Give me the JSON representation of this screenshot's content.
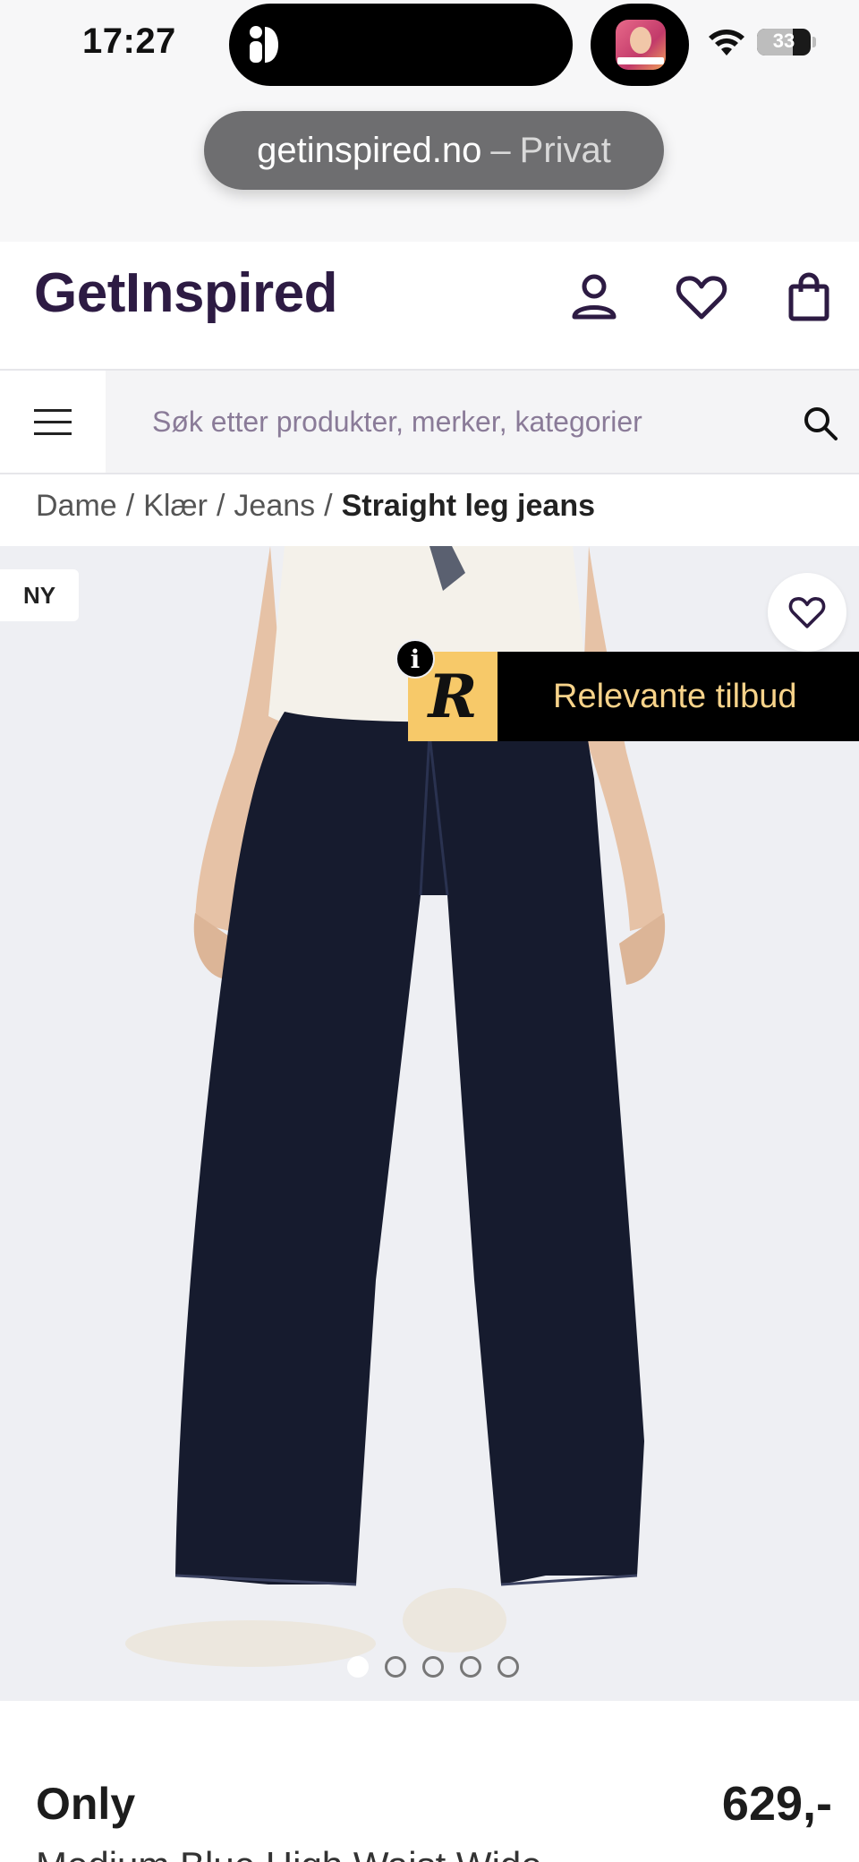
{
  "status_bar": {
    "time": "17:27",
    "battery": "33"
  },
  "browser": {
    "domain": "getinspired.no",
    "separator": "–",
    "mode": "Privat"
  },
  "header": {
    "logo": "GetInspired",
    "icons": [
      "user-icon",
      "heart-icon",
      "shopping-bag-icon"
    ],
    "brand_color": "#2d1b43"
  },
  "search": {
    "placeholder": "Søk etter produkter, merker, kategorier"
  },
  "breadcrumb": {
    "items": [
      "Dame",
      "Klær",
      "Jeans"
    ],
    "current": "Straight leg jeans"
  },
  "product": {
    "badge": "NY",
    "offer_logo": "R",
    "offer_text": "Relevante tilbud",
    "info_label": "i",
    "image_count": 5,
    "active_image": 1,
    "brand": "Only",
    "price": "629,-",
    "name": "Medium Blue High Waist Wide"
  }
}
